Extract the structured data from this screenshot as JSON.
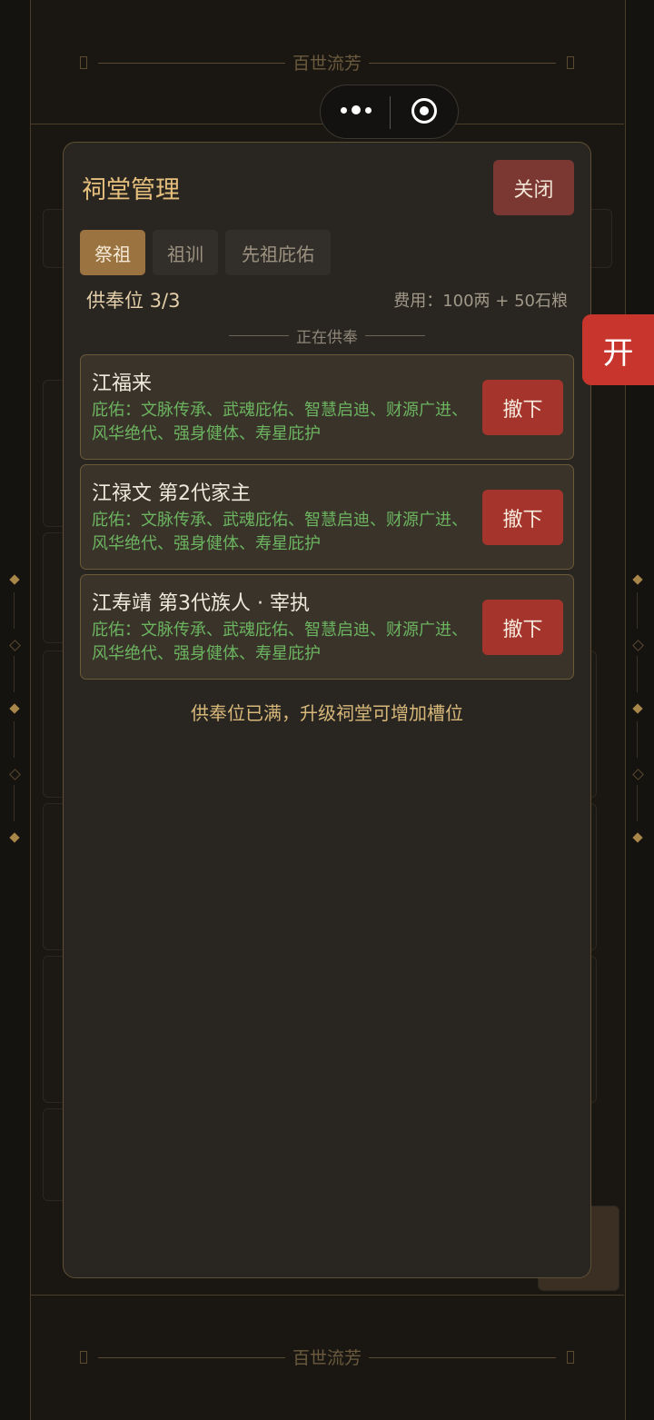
{
  "banner": {
    "title": "百世流芳"
  },
  "modal": {
    "title": "祠堂管理",
    "close_label": "关闭",
    "tabs": [
      {
        "label": "祭祖",
        "active": true
      },
      {
        "label": "祖训",
        "active": false
      },
      {
        "label": "先祖庇佑",
        "active": false
      }
    ],
    "slots_text": "供奉位 3/3",
    "cost_text": "费用：100两 + 50石粮",
    "section_title": "正在供奉",
    "ancestors": [
      {
        "name": "江福来",
        "blessing": "庇佑：文脉传承、武魂庇佑、智慧启迪、财源广进、风华绝代、强身健体、寿星庇护",
        "action": "撤下"
      },
      {
        "name": "江禄文  第2代家主",
        "blessing": "庇佑：文脉传承、武魂庇佑、智慧启迪、财源广进、风华绝代、强身健体、寿星庇护",
        "action": "撤下"
      },
      {
        "name": "江寿靖  第3代族人 · 宰执",
        "blessing": "庇佑：文脉传承、武魂庇佑、智慧启迪、财源广进、风华绝代、强身健体、寿星庇护",
        "action": "撤下"
      }
    ],
    "full_notice": "供奉位已满，升级祠堂可增加槽位"
  },
  "side_button": {
    "label": "开"
  },
  "colors": {
    "accent": "#e6c07c",
    "remove": "#a5352c",
    "blessing": "#6cb460",
    "open": "#c8352d"
  }
}
